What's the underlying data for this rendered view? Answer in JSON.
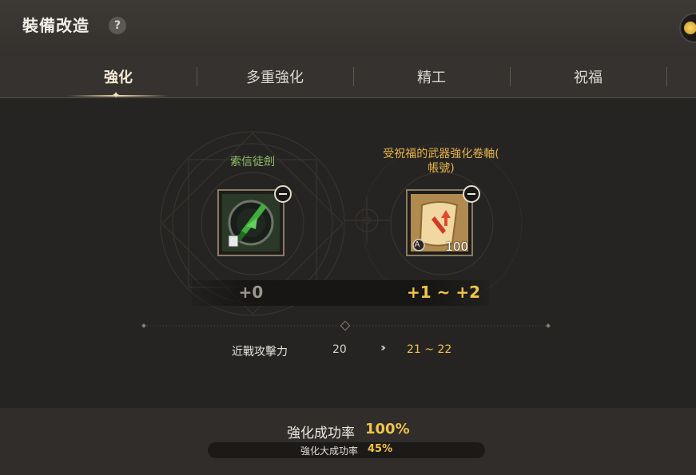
{
  "header": {
    "title": "裝備改造",
    "help_icon": "?",
    "currency_icon": "gold-coin-icon"
  },
  "tabs": [
    {
      "label": "強化",
      "active": true
    },
    {
      "label": "多重強化",
      "active": false
    },
    {
      "label": "精工",
      "active": false
    },
    {
      "label": "祝福",
      "active": false
    }
  ],
  "target_item": {
    "name": "索信徒劍",
    "name_color": "#8fc06a",
    "icon": "green-sword-shield-icon",
    "level_from": "+0"
  },
  "material_item": {
    "name_line1": "受祝福的武器強化卷軸(",
    "name_line2": "帳號)",
    "name_color": "#e8b54a",
    "icon": "scroll-icon",
    "badge": "A",
    "quantity": "100",
    "level_to": "+1 ~ +2"
  },
  "stat": {
    "label": "近戰攻擊力",
    "from": "20",
    "to": "21 ~ 22"
  },
  "success": {
    "label": "強化成功率",
    "value": "100%"
  },
  "great_success": {
    "label": "強化大成功率",
    "value": "45%"
  },
  "colors": {
    "accent": "#f1c34b",
    "background": "#262422"
  }
}
